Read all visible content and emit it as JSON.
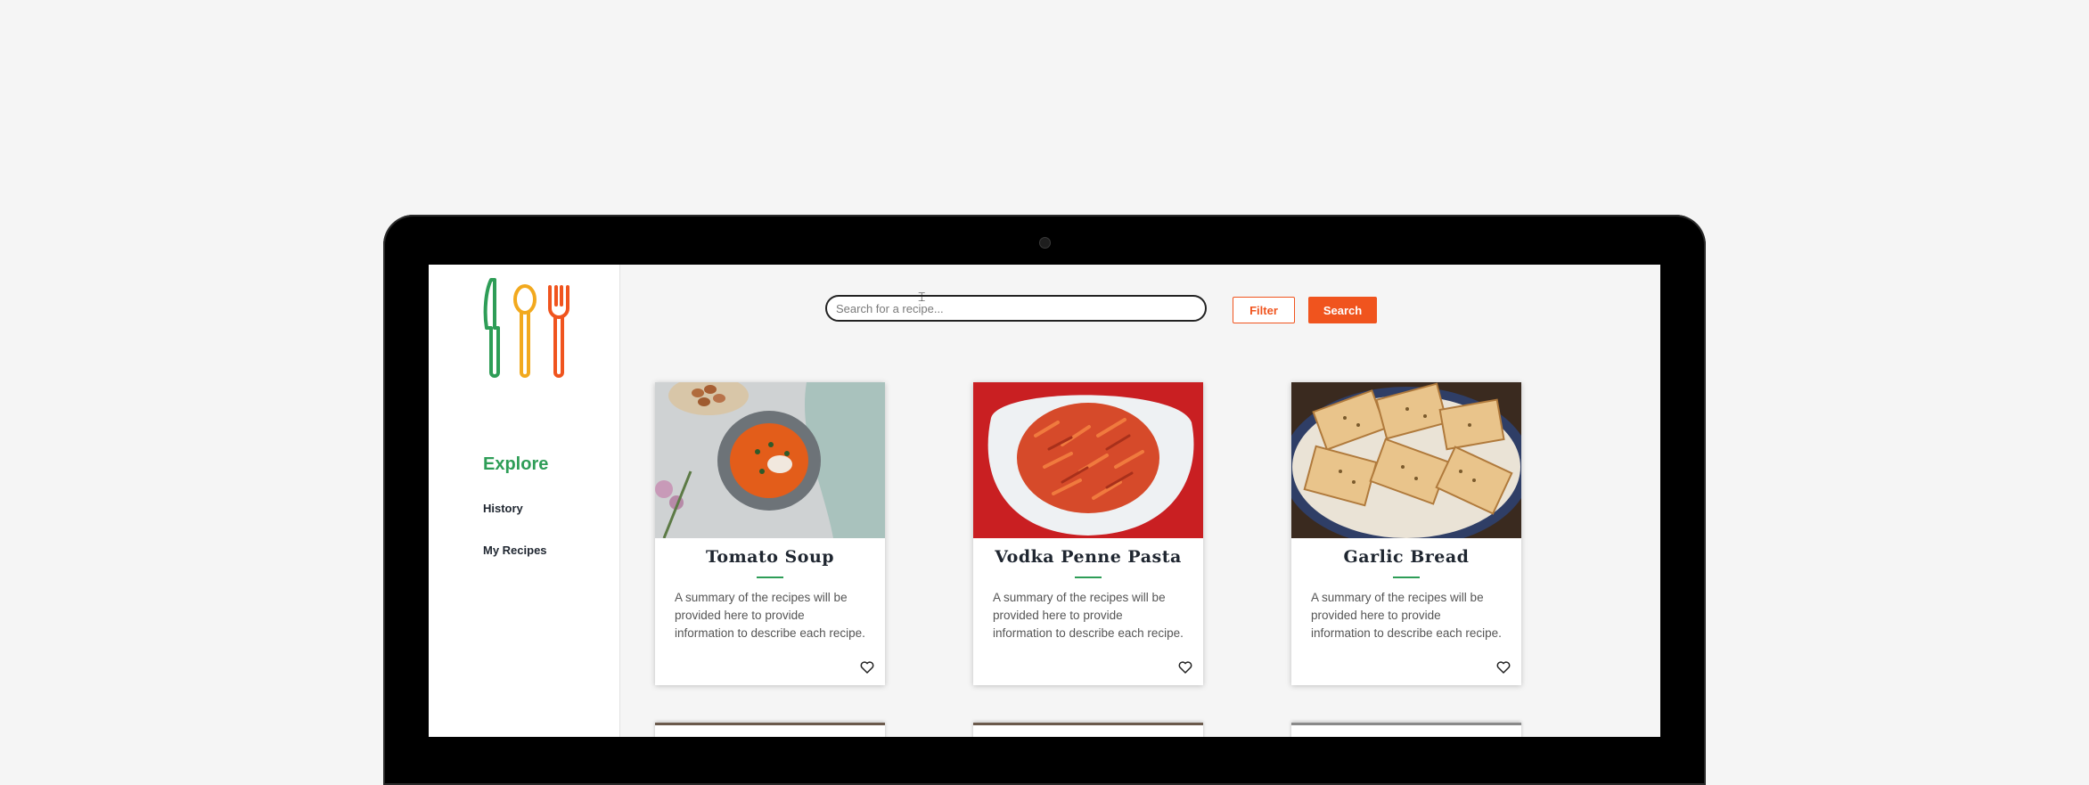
{
  "sidebar": {
    "logo_alt": "utensils-logo",
    "nav": {
      "explore": "Explore",
      "history": "History",
      "my_recipes": "My Recipes"
    }
  },
  "search": {
    "placeholder": "Search for a recipe...",
    "filter_label": "Filter",
    "search_label": "Search"
  },
  "recipes": [
    {
      "title": "Tomato Soup",
      "summary": "A summary of the recipes will be provided here to provide information to describe each recipe.",
      "favorite_icon": "heart-icon"
    },
    {
      "title": "Vodka Penne Pasta",
      "summary": "A summary of the recipes will be provided here to provide information to describe each recipe.",
      "favorite_icon": "heart-icon"
    },
    {
      "title": "Garlic Bread",
      "summary": "A summary of the recipes will be provided here to provide information to describe each recipe.",
      "favorite_icon": "heart-icon"
    }
  ],
  "colors": {
    "brand_green": "#2e9d57",
    "brand_yellow": "#f2a91e",
    "brand_orange": "#f0541e",
    "text_dark": "#1f2630"
  }
}
